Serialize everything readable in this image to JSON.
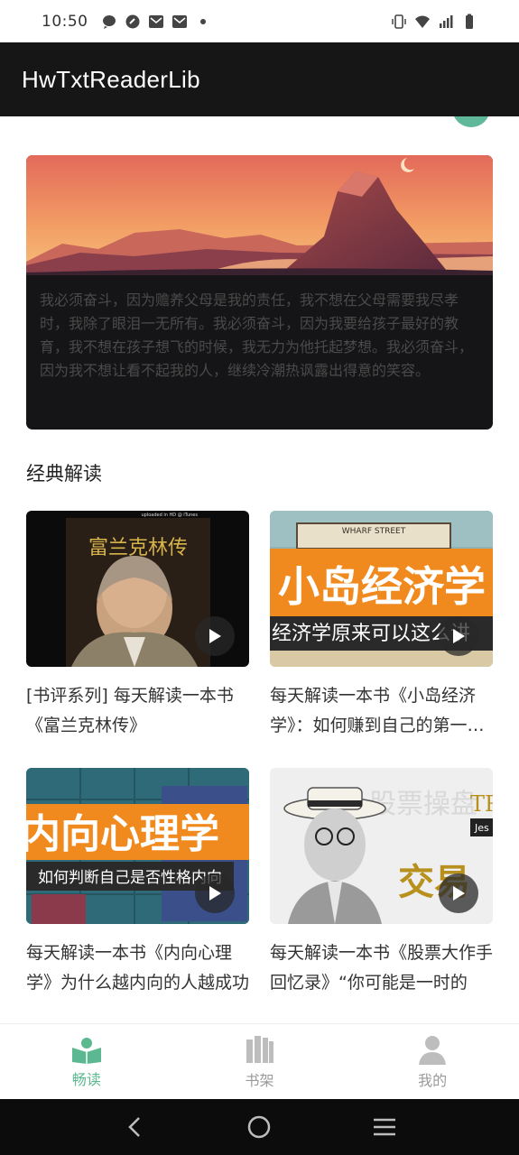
{
  "status_bar": {
    "time": "10:50",
    "left_icons": [
      "message-icon",
      "sync-icon",
      "mail-icon",
      "mail-icon",
      "dot-icon"
    ],
    "right_icons": [
      "vibrate-icon",
      "wifi-icon",
      "signal-icon",
      "battery-icon"
    ]
  },
  "app_bar": {
    "title": "HwTxtReaderLib"
  },
  "hero": {
    "text": "我必须奋斗，因为赡养父母是我的责任，我不想在父母需要我尽孝时，我除了眼泪一无所有。我必须奋斗，因为我要给孩子最好的教育，我不想在孩子想飞的时候，我无力为他托起梦想。我必须奋斗，因为我不想让看不起我的人，继续冷潮热讽露出得意的笑容。"
  },
  "section": {
    "title": "经典解读"
  },
  "videos": [
    {
      "title": "[书评系列] 每天解读一本书《富兰克林传》",
      "thumb_text": "富兰克林传",
      "thumb_watermark": "uploaded in HD @ iTunes"
    },
    {
      "title": "每天解读一本书《小岛经济学》：如何赚到自己的第一桶金",
      "thumb_text": "小岛经济学",
      "thumb_sub": "经济学原来可以这么讲",
      "thumb_sign": "WHARF STREET"
    },
    {
      "title": "每天解读一本书《内向心理学》为什么越内向的人越成功",
      "thumb_text": "内向心理学",
      "thumb_sub": "如何判断自己是否性格内向"
    },
    {
      "title": "每天解读一本书《股票大作手回忆录》“你可能是一时的",
      "thumb_text": "交易",
      "thumb_sub": "股票操盘",
      "thumb_corner": "TRA",
      "thumb_corner2": "Jes"
    }
  ],
  "bottom_nav": [
    {
      "label": "畅读",
      "icon": "reading-icon",
      "active": true
    },
    {
      "label": "书架",
      "icon": "bookshelf-icon",
      "active": false
    },
    {
      "label": "我的",
      "icon": "profile-icon",
      "active": false
    }
  ],
  "colors": {
    "accent": "#5cb891",
    "app_bar": "#161616",
    "hero_bg": "#151517"
  }
}
